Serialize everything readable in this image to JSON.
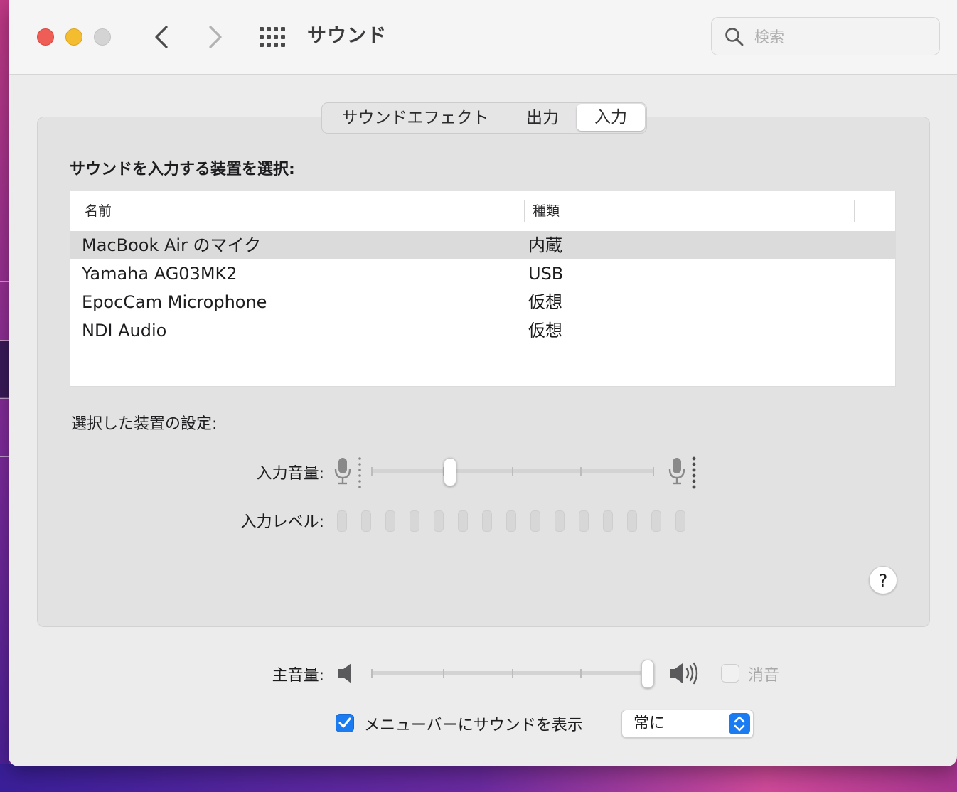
{
  "window": {
    "title": "サウンド"
  },
  "search": {
    "placeholder": "検索"
  },
  "tabs": [
    {
      "label": "サウンドエフェクト",
      "selected": false
    },
    {
      "label": "出力",
      "selected": false
    },
    {
      "label": "入力",
      "selected": true
    }
  ],
  "input_section": {
    "heading": "サウンドを入力する装置を選択:",
    "table": {
      "columns": [
        "名前",
        "種類"
      ],
      "rows": [
        {
          "name": "MacBook Air のマイク",
          "kind": "内蔵",
          "selected": true
        },
        {
          "name": "Yamaha AG03MK2",
          "kind": "USB",
          "selected": false
        },
        {
          "name": "EpocCam Microphone",
          "kind": "仮想",
          "selected": false
        },
        {
          "name": "NDI Audio",
          "kind": "仮想",
          "selected": false
        }
      ]
    },
    "settings_label": "選択した装置の設定:",
    "input_volume": {
      "label": "入力音量:",
      "value": 0.28
    },
    "input_level": {
      "label": "入力レベル:",
      "segments": 15,
      "lit": 0
    }
  },
  "help": {
    "label": "?"
  },
  "output_volume": {
    "label": "主音量:",
    "value": 1.0
  },
  "mute": {
    "label": "消音",
    "checked": false
  },
  "menubar": {
    "label": "メニューバーにサウンドを表示",
    "checked": true,
    "popup_value": "常に"
  },
  "colors": {
    "accent": "#1b7cf2",
    "close": "#ee5d56",
    "minimize": "#f4bd2f"
  }
}
